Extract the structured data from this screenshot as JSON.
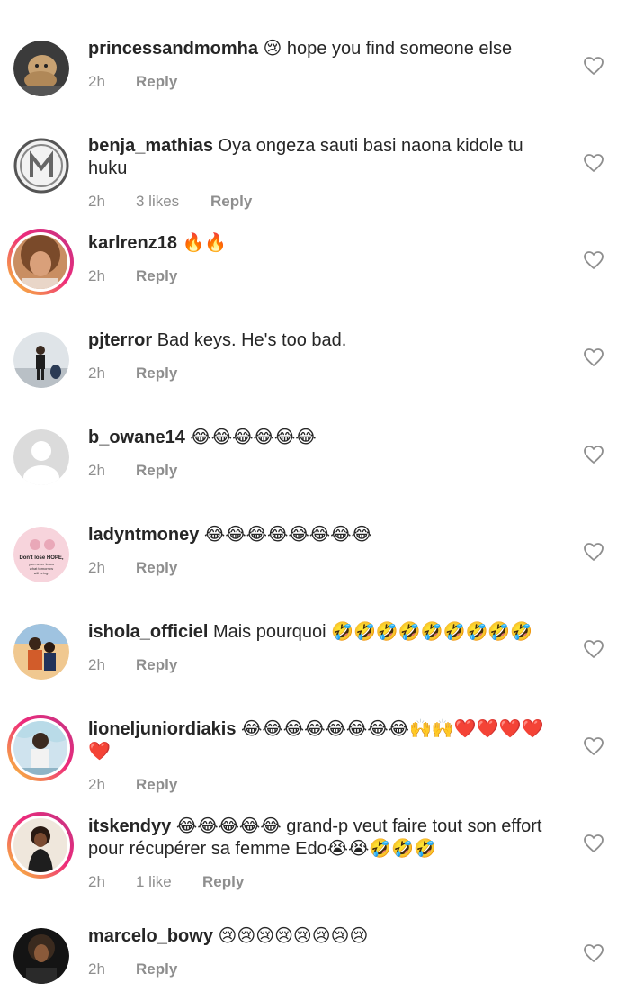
{
  "comments": [
    {
      "username": "princessandmomha",
      "text": "😢 hope you find someone else",
      "time": "2h",
      "likes": "",
      "reply": "Reply"
    },
    {
      "username": "benja_mathias",
      "text": "Oya ongeza sauti basi naona kidole tu huku",
      "time": "2h",
      "likes": "3 likes",
      "reply": "Reply"
    },
    {
      "username": "karlrenz18",
      "text": "🔥🔥",
      "time": "2h",
      "likes": "",
      "reply": "Reply"
    },
    {
      "username": "pjterror",
      "text": "Bad keys. He's too bad.",
      "time": "2h",
      "likes": "",
      "reply": "Reply"
    },
    {
      "username": "b_owane14",
      "text": "😂😂😂😂😂😂",
      "time": "2h",
      "likes": "",
      "reply": "Reply"
    },
    {
      "username": "ladyntmoney",
      "text": "😂😂😂😂😂😂😂😂",
      "time": "2h",
      "likes": "",
      "reply": "Reply",
      "avatar_text": "Don't lose HOPE, you never know what tomorrow will bring."
    },
    {
      "username": "ishola_officiel",
      "text": "Mais pourquoi 🤣🤣🤣🤣🤣🤣🤣🤣🤣",
      "time": "2h",
      "likes": "",
      "reply": "Reply"
    },
    {
      "username": "lioneljuniordiakis",
      "text": "😂😂😂😂😂😂😂😂🙌🙌❤️❤️❤️❤️❤️",
      "time": "2h",
      "likes": "",
      "reply": "Reply"
    },
    {
      "username": "itskendyy",
      "text": "😂😂😂😂😂 grand-p veut faire tout son effort pour récupérer sa femme Edo😭😭🤣🤣🤣",
      "time": "2h",
      "likes": "1 like",
      "reply": "Reply"
    },
    {
      "username": "marcelo_bowy",
      "text": "😢😢😢😢😢😢😢😢",
      "time": "2h",
      "likes": "",
      "reply": "Reply"
    }
  ],
  "icons": {
    "like": "heart-outline-icon"
  },
  "colors": {
    "text": "#262626",
    "meta": "#8e8e8e",
    "story_ring_start": "#f9ce34",
    "story_ring_end": "#c13584"
  }
}
